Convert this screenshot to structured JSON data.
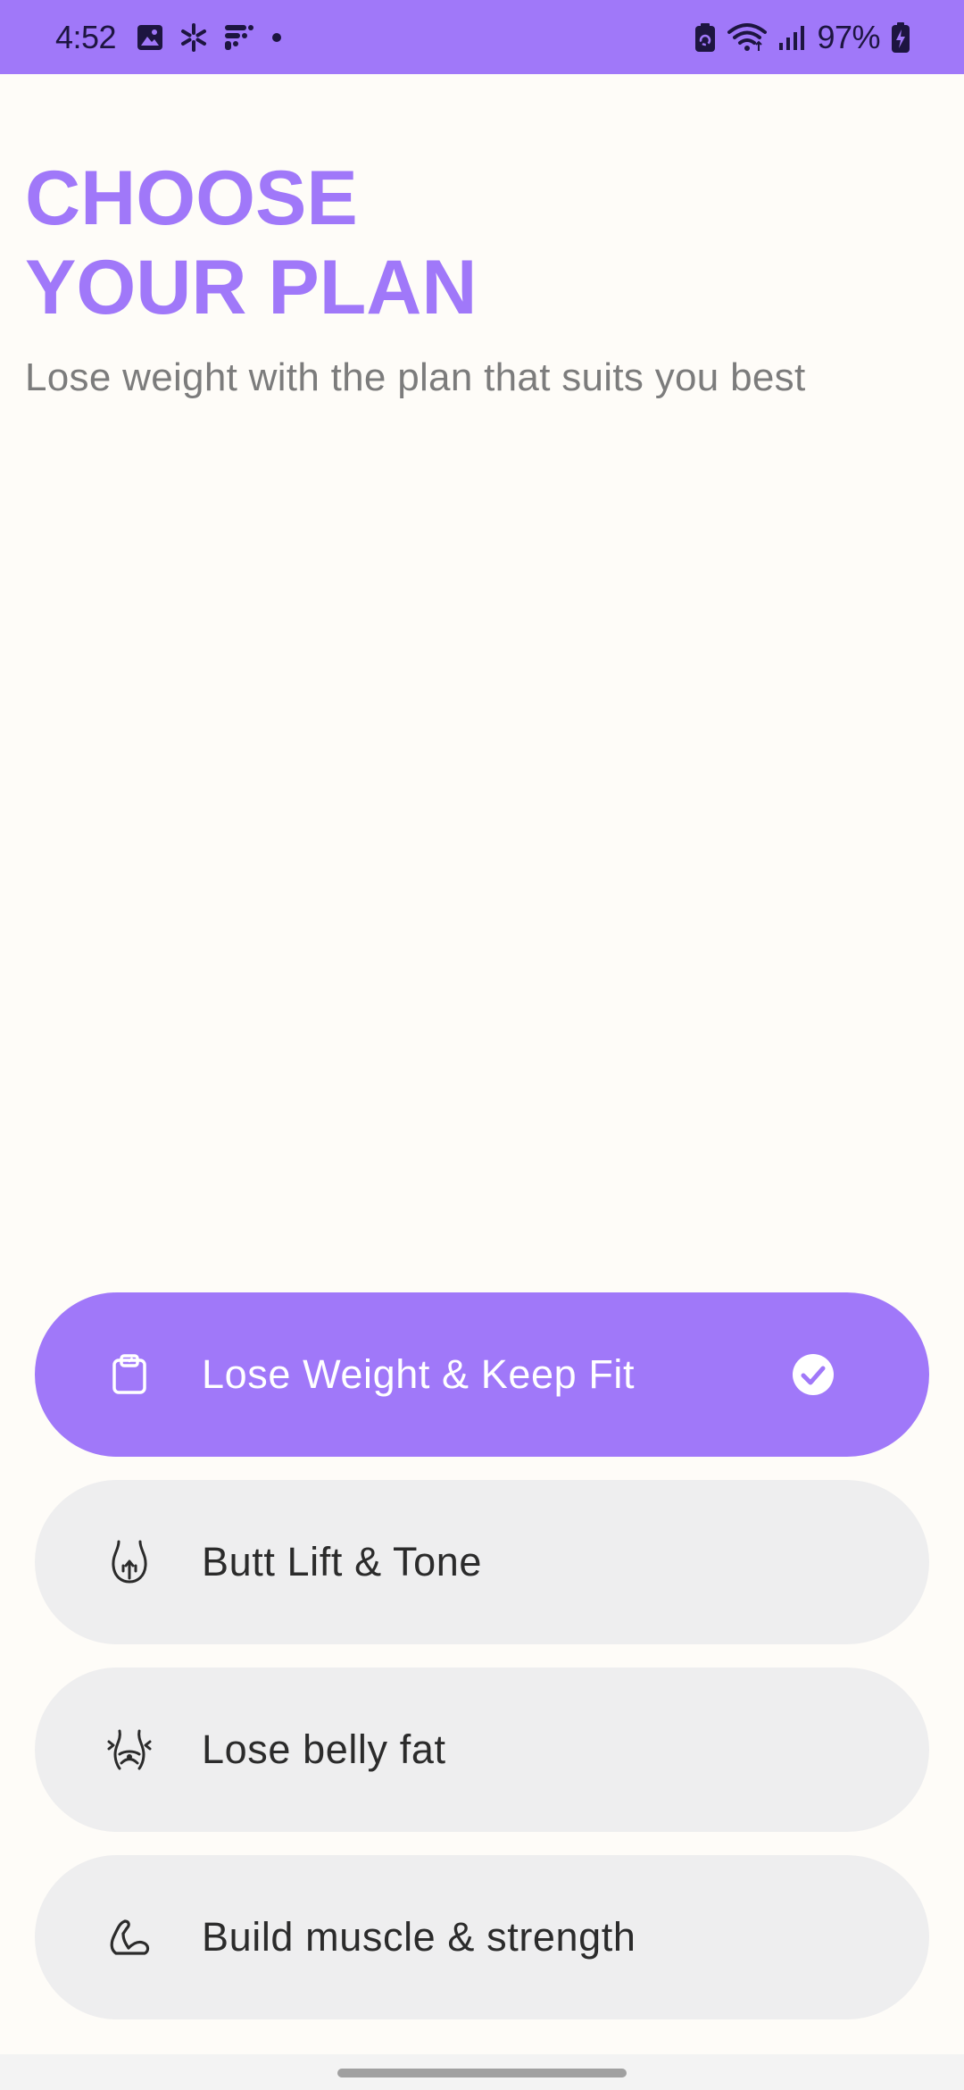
{
  "status_bar": {
    "time": "4:52",
    "battery_percent": "97%",
    "left_icons": [
      "gallery-icon",
      "walmart-spark-icon",
      "fitness-app-icon",
      "dot-icon"
    ],
    "right_icons": [
      "battery-saver-icon",
      "wifi-icon",
      "signal-icon",
      "battery-charging-icon"
    ]
  },
  "header": {
    "title_line1": "CHOOSE",
    "title_line2": "YOUR PLAN",
    "subtitle": "Lose weight with the plan that suits you best"
  },
  "plans": [
    {
      "label": "Lose Weight & Keep Fit",
      "icon": "clipboard-scale-icon",
      "selected": true
    },
    {
      "label": "Butt Lift & Tone",
      "icon": "butt-icon",
      "selected": false
    },
    {
      "label": "Lose belly fat",
      "icon": "belly-icon",
      "selected": false
    },
    {
      "label": "Build muscle & strength",
      "icon": "flexed-arm-icon",
      "selected": false
    }
  ],
  "colors": {
    "accent": "#A078F9",
    "background": "#FEFCF8",
    "option_bg": "#EEEEEF",
    "subtitle_text": "#7C7C7C"
  }
}
